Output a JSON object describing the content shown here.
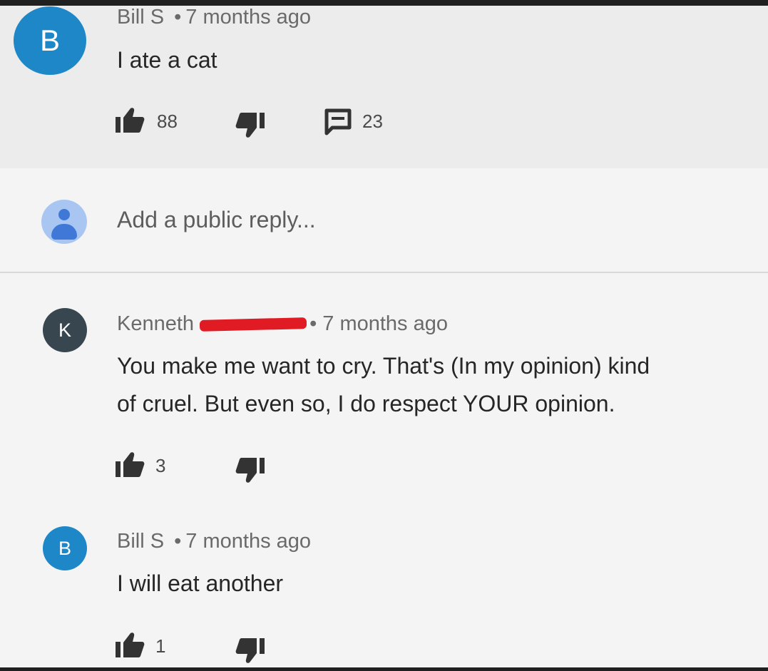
{
  "comment": {
    "avatar_letter": "B",
    "author": "Bill S",
    "separator": "•",
    "time": "7 months ago",
    "text": "I ate a cat",
    "likes": "88",
    "replies": "23"
  },
  "reply_input": {
    "placeholder": "Add a public reply..."
  },
  "replies": [
    {
      "avatar_letter": "K",
      "author": "Kenneth",
      "separator": "•",
      "time": "7 months ago",
      "text_line1": "You make me want to cry. That's (In my opinion) kind",
      "text_line2": "of cruel. But even so, I do respect YOUR opinion.",
      "likes": "3"
    },
    {
      "avatar_letter": "B",
      "author": "Bill S",
      "separator": "•",
      "time": "7 months ago",
      "text": "I will eat another",
      "likes": "1"
    }
  ],
  "colors": {
    "avatar_blue": "#1e87c8",
    "avatar_dark": "#38474f",
    "redaction": "#e01b24"
  }
}
